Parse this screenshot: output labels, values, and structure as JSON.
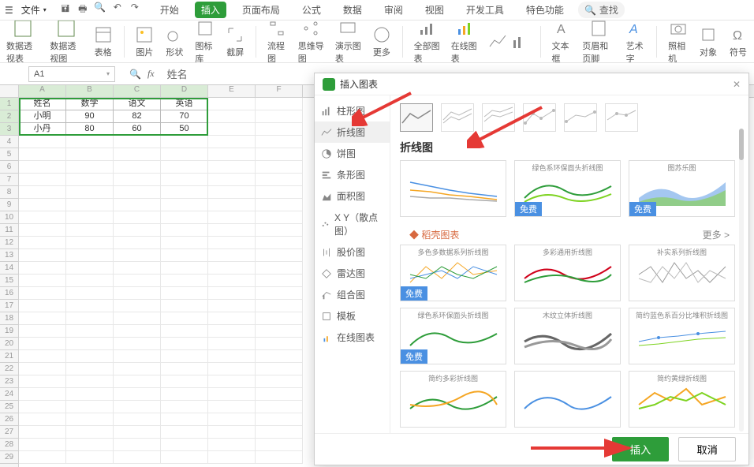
{
  "titlebar": {
    "file_label": "文件",
    "menu_tabs": [
      "开始",
      "插入",
      "页面布局",
      "公式",
      "数据",
      "审阅",
      "视图",
      "开发工具",
      "特色功能"
    ],
    "active_tab": "插入",
    "search_label": "查找"
  },
  "ribbon": [
    {
      "name": "pivot-table",
      "label": "数据透视表"
    },
    {
      "name": "pivot-chart",
      "label": "数据透视图"
    },
    {
      "name": "table",
      "label": "表格"
    },
    {
      "name": "picture",
      "label": "图片"
    },
    {
      "name": "shape",
      "label": "形状"
    },
    {
      "name": "icon-lib",
      "label": "图标库"
    },
    {
      "name": "screenshot",
      "label": "截屏"
    },
    {
      "name": "flow",
      "label": "流程图"
    },
    {
      "name": "mind",
      "label": "思维导图"
    },
    {
      "name": "present",
      "label": "演示图表"
    },
    {
      "name": "more",
      "label": "更多"
    },
    {
      "name": "all-charts",
      "label": "全部图表"
    },
    {
      "name": "online-chart",
      "label": "在线图表"
    },
    {
      "name": "sparks",
      "label": ""
    },
    {
      "name": "textbox",
      "label": "文本框"
    },
    {
      "name": "headfoot",
      "label": "页眉和页脚"
    },
    {
      "name": "wordart",
      "label": "艺术字"
    },
    {
      "name": "camera",
      "label": "照相机"
    },
    {
      "name": "object",
      "label": "对象"
    },
    {
      "name": "symbol",
      "label": "符号"
    }
  ],
  "namebox": "A1",
  "formula": "姓名",
  "columns": [
    "A",
    "B",
    "C",
    "D",
    "E",
    "F"
  ],
  "data": {
    "headers": [
      "姓名",
      "数学",
      "语文",
      "英语"
    ],
    "rows": [
      [
        "小明",
        "90",
        "82",
        "70"
      ],
      [
        "小丹",
        "80",
        "60",
        "50"
      ]
    ]
  },
  "dialog": {
    "title": "插入图表",
    "chart_types": [
      "柱形图",
      "折线图",
      "饼图",
      "条形图",
      "面积图",
      "X Y（散点图）",
      "股价图",
      "雷达图",
      "组合图",
      "模板",
      "在线图表"
    ],
    "active_type": "折线图",
    "preview_title": "折线图",
    "free_badge": "免费",
    "section": "稻壳图表",
    "more": "更多 >",
    "thumb_titles": [
      "绿色系环保面头折线图",
      "图苏乐图",
      "多色多数据系列折线图",
      "多彩通用折线图",
      "补实系列折线图",
      "绿色系环保面头折线图",
      "木纹立体折线图",
      "简约蓝色系百分比堆积折线图",
      "简约多彩折线图",
      "",
      "简约黄绿折线图"
    ],
    "insert_btn": "插入",
    "cancel_btn": "取消"
  }
}
